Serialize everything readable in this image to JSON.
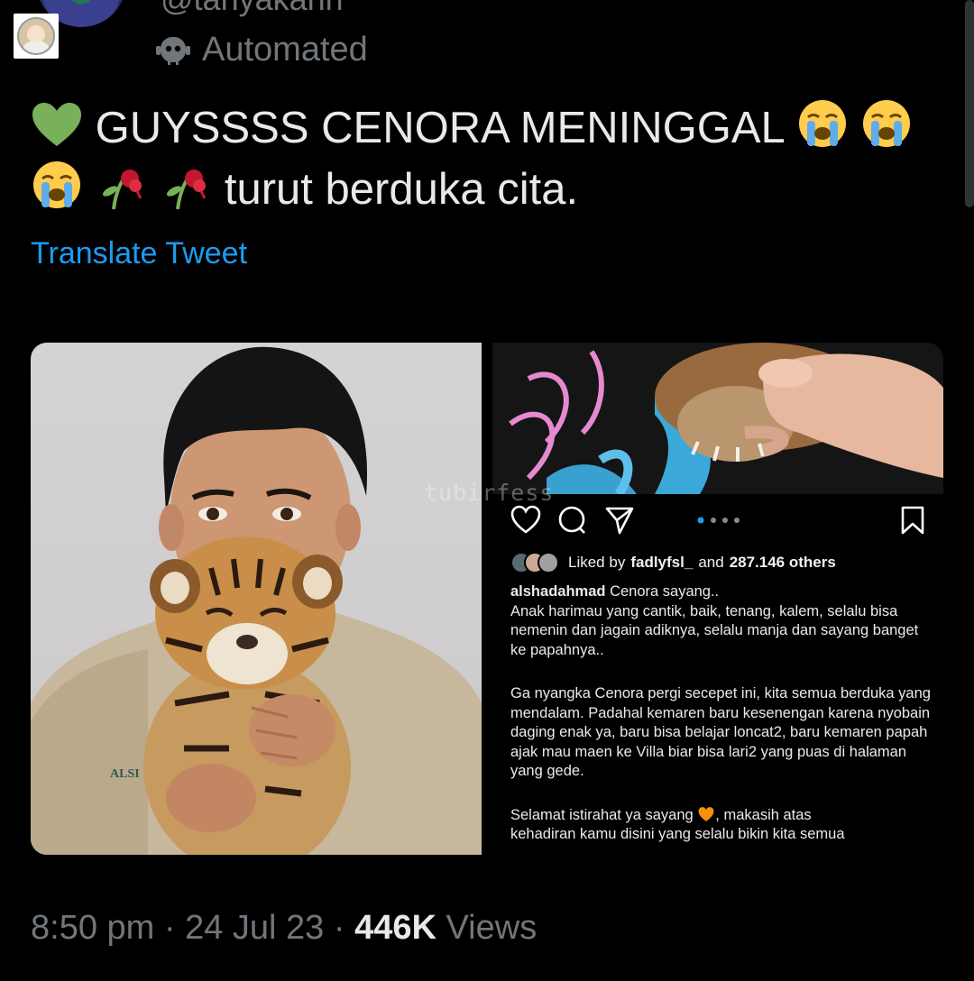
{
  "header": {
    "handle": "@tanyakanrl",
    "label_icon": "robot-icon",
    "automated": "Automated"
  },
  "tweet": {
    "line1_text": "GUYSSSS CENORA MENINGGAL",
    "line2_text": "turut berduka cita.",
    "emojis": [
      "green-heart",
      "loudly-crying-face",
      "loudly-crying-face",
      "loudly-crying-face",
      "wilted-flower",
      "wilted-flower"
    ],
    "translate": "Translate Tweet"
  },
  "media": {
    "watermark": "tubirfess",
    "left_photo_caption": "ALSI",
    "instagram": {
      "liked_prefix": "Liked by",
      "liked_user": "fadlyfsl_",
      "liked_and": "and",
      "liked_count": "287.146 others",
      "caption_user": "alshadahmad",
      "caption_title": "Cenora sayang..",
      "para1": "Anak harimau yang cantik, baik, tenang, kalem, selalu bisa nemenin dan jagain adiknya, selalu manja dan sayang banget ke papahnya..",
      "para2": "Ga nyangka Cenora pergi secepet ini, kita semua berduka yang mendalam. Padahal kemaren baru kesenengan karena nyobain daging enak ya, baru bisa belajar loncat2, baru kemaren papah ajak mau maen ke Villa biar bisa lari2 yang puas di halaman yang gede.",
      "para3_a": "Selamat istirahat ya sayang",
      "para3_b": ", makasih atas",
      "para3_c": "kehadiran kamu disini yang selalu bikin kita semua",
      "carousel_dots": 4
    }
  },
  "meta": {
    "time": "8:50 pm",
    "sep": "·",
    "date": "24 Jul 23",
    "views_count": "446K",
    "views_label": "Views"
  }
}
